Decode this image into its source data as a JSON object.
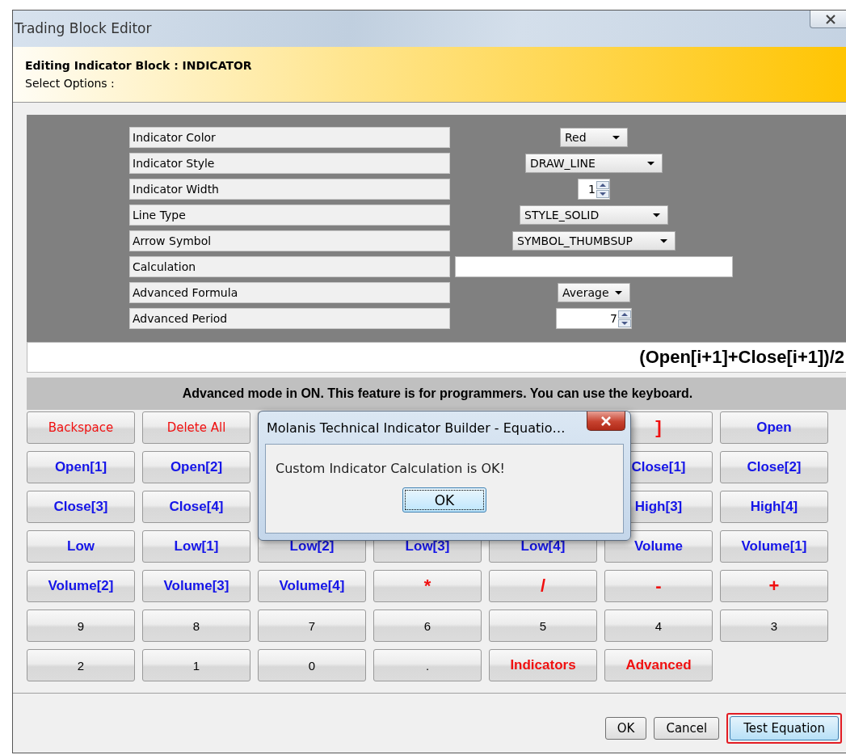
{
  "window": {
    "title": "Trading Block Editor"
  },
  "header": {
    "title": "Editing Indicator Block : INDICATOR",
    "subtitle": "Select Options :"
  },
  "options": [
    {
      "label": "Indicator Color",
      "kind": "select",
      "value": "Red"
    },
    {
      "label": "Indicator Style",
      "kind": "select",
      "value": "DRAW_LINE"
    },
    {
      "label": "Indicator Width",
      "kind": "spin",
      "value": "1"
    },
    {
      "label": "Line Type",
      "kind": "select",
      "value": "STYLE_SOLID"
    },
    {
      "label": "Arrow Symbol",
      "kind": "select",
      "value": "SYMBOL_THUMBSUP"
    },
    {
      "label": "Calculation",
      "kind": "text"
    },
    {
      "label": "Advanced Formula",
      "kind": "select",
      "value": "Average"
    },
    {
      "label": "Advanced Period",
      "kind": "spin",
      "value": "7"
    }
  ],
  "formula": "(Open[i+1]+Close[i+1])/2",
  "mode_notice": "Advanced mode in ON. This feature is for programmers. You can use the keyboard.",
  "keypad": [
    [
      {
        "kind": "edit",
        "label": "Backspace"
      },
      {
        "kind": "edit",
        "label": "Delete All"
      },
      {
        "kind": "hidden"
      },
      {
        "kind": "hidden"
      },
      {
        "kind": "hidden"
      },
      {
        "kind": "operator",
        "label": "]"
      },
      {
        "kind": "operand",
        "label": "Open"
      }
    ],
    [
      {
        "kind": "operand",
        "label": "Open[1]"
      },
      {
        "kind": "operand",
        "label": "Open[2]"
      },
      {
        "kind": "hidden"
      },
      {
        "kind": "hidden"
      },
      {
        "kind": "hidden"
      },
      {
        "kind": "operand",
        "label": "Close[1]"
      },
      {
        "kind": "operand",
        "label": "Close[2]"
      }
    ],
    [
      {
        "kind": "operand",
        "label": "Close[3]"
      },
      {
        "kind": "operand",
        "label": "Close[4]"
      },
      {
        "kind": "hidden"
      },
      {
        "kind": "hidden"
      },
      {
        "kind": "hidden"
      },
      {
        "kind": "operand",
        "label": "High[3]"
      },
      {
        "kind": "operand",
        "label": "High[4]"
      }
    ],
    [
      {
        "kind": "operand",
        "label": "Low"
      },
      {
        "kind": "operand",
        "label": "Low[1]"
      },
      {
        "kind": "operand",
        "label": "Low[2]"
      },
      {
        "kind": "operand",
        "label": "Low[3]"
      },
      {
        "kind": "operand",
        "label": "Low[4]"
      },
      {
        "kind": "operand",
        "label": "Volume"
      },
      {
        "kind": "operand",
        "label": "Volume[1]"
      }
    ],
    [
      {
        "kind": "operand",
        "label": "Volume[2]"
      },
      {
        "kind": "operand",
        "label": "Volume[3]"
      },
      {
        "kind": "operand",
        "label": "Volume[4]"
      },
      {
        "kind": "operator",
        "label": "*"
      },
      {
        "kind": "operator",
        "label": "/"
      },
      {
        "kind": "operator",
        "label": "-"
      },
      {
        "kind": "operator",
        "label": "+"
      }
    ],
    [
      {
        "kind": "digit",
        "label": "9"
      },
      {
        "kind": "digit",
        "label": "8"
      },
      {
        "kind": "digit",
        "label": "7"
      },
      {
        "kind": "digit",
        "label": "6"
      },
      {
        "kind": "digit",
        "label": "5"
      },
      {
        "kind": "digit",
        "label": "4"
      },
      {
        "kind": "digit",
        "label": "3"
      }
    ],
    [
      {
        "kind": "digit",
        "label": "2"
      },
      {
        "kind": "digit",
        "label": "1"
      },
      {
        "kind": "digit",
        "label": "0"
      },
      {
        "kind": "digit",
        "label": "."
      },
      {
        "kind": "special",
        "label": "Indicators"
      },
      {
        "kind": "special",
        "label": "Advanced"
      }
    ]
  ],
  "dialog": {
    "title": "Molanis Technical Indicator Builder - Equatio…",
    "message": "Custom Indicator Calculation is OK!",
    "button": "OK"
  },
  "buttons": [
    {
      "label": "OK",
      "highlighted": false
    },
    {
      "label": "Cancel",
      "highlighted": false
    },
    {
      "label": "Test Equation",
      "highlighted": true
    }
  ]
}
